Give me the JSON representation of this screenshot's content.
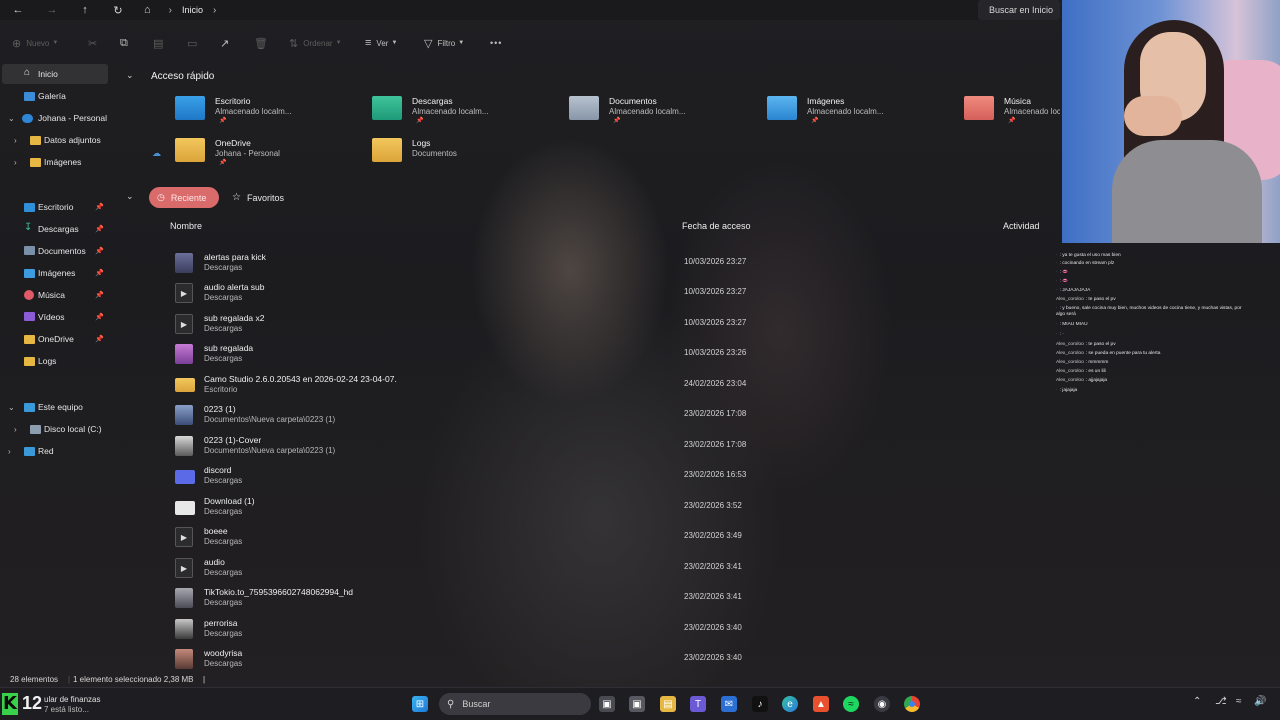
{
  "address": {
    "breadcrumb": "Inicio",
    "search_placeholder": "Buscar en Inicio"
  },
  "toolbar": {
    "new_label": "Nuevo",
    "sort_label": "Ordenar",
    "view_label": "Ver",
    "filter_label": "Filtro",
    "more_label": "•••"
  },
  "sidebar": {
    "items": [
      {
        "label": "Inicio"
      },
      {
        "label": "Galería"
      },
      {
        "label": "Johana - Personal"
      },
      {
        "label": "Datos adjuntos"
      },
      {
        "label": "Imágenes"
      },
      {
        "label": "Escritorio"
      },
      {
        "label": "Descargas"
      },
      {
        "label": "Documentos"
      },
      {
        "label": "Imágenes"
      },
      {
        "label": "Música"
      },
      {
        "label": "Vídeos"
      },
      {
        "label": "OneDrive"
      },
      {
        "label": "Logs"
      },
      {
        "label": "Este equipo"
      },
      {
        "label": "Disco local (C:)"
      },
      {
        "label": "Red"
      }
    ]
  },
  "quick_access": {
    "title": "Acceso rápido",
    "tiles": [
      {
        "name": "Escritorio",
        "sub": "Almacenado localm..."
      },
      {
        "name": "Descargas",
        "sub": "Almacenado localm..."
      },
      {
        "name": "Documentos",
        "sub": "Almacenado localm..."
      },
      {
        "name": "Imágenes",
        "sub": "Almacenado localm..."
      },
      {
        "name": "Música",
        "sub": "Almacenado loca"
      },
      {
        "name": "OneDrive",
        "sub": "Johana - Personal"
      },
      {
        "name": "Logs",
        "sub": "Documentos"
      }
    ]
  },
  "filters": {
    "recent": "Reciente",
    "favorites": "Favoritos"
  },
  "columns": {
    "name": "Nombre",
    "date": "Fecha de acceso",
    "activity": "Actividad"
  },
  "files": [
    {
      "name": "alertas para kick",
      "location": "Descargas",
      "date": "10/03/2026 23:27"
    },
    {
      "name": "audio alerta sub",
      "location": "Descargas",
      "date": "10/03/2026 23:27"
    },
    {
      "name": "sub regalada x2",
      "location": "Descargas",
      "date": "10/03/2026 23:27"
    },
    {
      "name": "sub regalada",
      "location": "Descargas",
      "date": "10/03/2026 23:26"
    },
    {
      "name": "Camo Studio 2.6.0.20543 en 2026-02-24 23-04-07.",
      "location": "Escritorio",
      "date": "24/02/2026 23:04"
    },
    {
      "name": "0223 (1)",
      "location": "Documentos\\Nueva carpeta\\0223 (1)",
      "date": "23/02/2026 17:08"
    },
    {
      "name": "0223 (1)-Cover",
      "location": "Documentos\\Nueva carpeta\\0223 (1)",
      "date": "23/02/2026 17:08"
    },
    {
      "name": "discord",
      "location": "Descargas",
      "date": "23/02/2026 16:53"
    },
    {
      "name": "Download (1)",
      "location": "Descargas",
      "date": "23/02/2026 3:52"
    },
    {
      "name": "boeee",
      "location": "Descargas",
      "date": "23/02/2026 3:49"
    },
    {
      "name": "audio",
      "location": "Descargas",
      "date": "23/02/2026 3:41"
    },
    {
      "name": "TikTokio.to_7595396602748062994_hd",
      "location": "Descargas",
      "date": "23/02/2026 3:41"
    },
    {
      "name": "perrorisa",
      "location": "Descargas",
      "date": "23/02/2026 3:40"
    },
    {
      "name": "woodyrisa",
      "location": "Descargas",
      "date": "23/02/2026 3:40"
    }
  ],
  "status": {
    "count": "28 elementos",
    "selected": "1 elemento seleccionado  2,38 MB"
  },
  "chat": [
    {
      "user": "·",
      "text": ": ya te gusta el uso mas bien"
    },
    {
      "user": "·",
      "text": ": cocinando en stream plz"
    },
    {
      "user": "·",
      "text": ": 👄"
    },
    {
      "user": "·",
      "text": ": 👄"
    },
    {
      "user": "·",
      "text": ": JAJAJAJAJA"
    },
    {
      "user": "Alex_coroloo",
      "text": ": te paso el pv"
    },
    {
      "user": "·",
      "text": ": y bueno, sale cocina muy bien, muchos videos de cocina tiene, y muchas vistas, por algo será"
    },
    {
      "user": "·",
      "text": ": MIAU MIAU"
    },
    {
      "user": "·",
      "text": ": ·"
    },
    {
      "user": "Alex_coroloo",
      "text": ": te paso el pv"
    },
    {
      "user": "Alex_coroloo",
      "text": ": se pueda en puente para tu alerta"
    },
    {
      "user": "Alex_coroloo",
      "text": ": mmmmm"
    },
    {
      "user": "Alex_coroloo",
      "text": ": es un lili"
    },
    {
      "user": "Alex_coroloo",
      "text": ": ajjajajaja"
    },
    {
      "user": "·",
      "text": ": jajajaja"
    }
  ],
  "taskbar": {
    "widget_number": "12",
    "widget_line1": "ular de finanzas",
    "widget_line2": "7 está listo...",
    "search_label": "Buscar"
  },
  "colors": {
    "accent_chip": "#d96b6b",
    "folder_yellow": "#e7b743",
    "kick_green": "#3ad14a"
  }
}
